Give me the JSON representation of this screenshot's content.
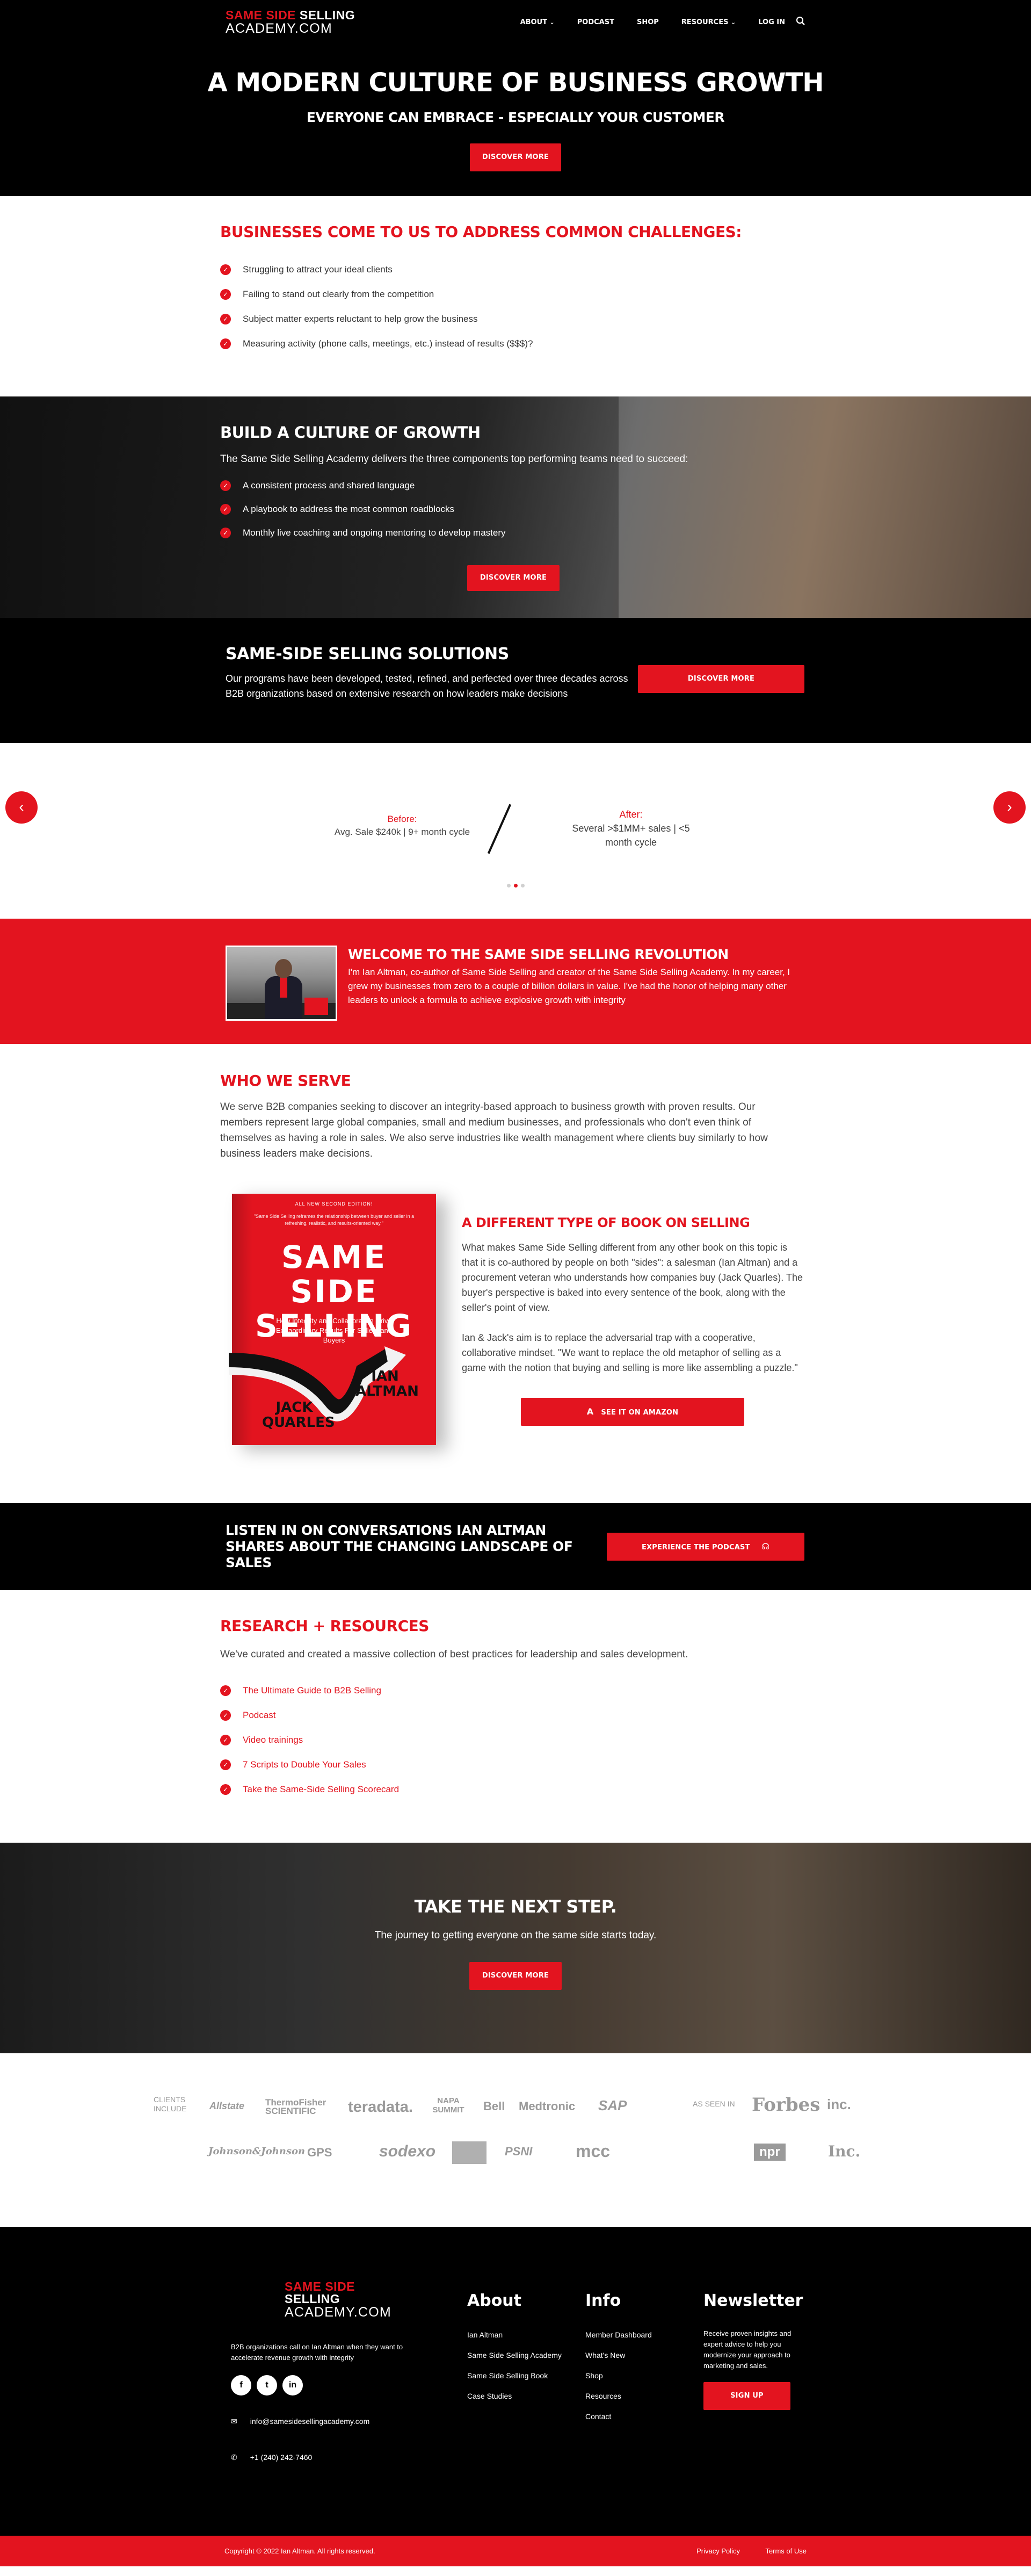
{
  "header": {
    "logo_red": "SAME SIDE",
    "logo_white": "SELLING",
    "logo_sub": "ACADEMY.COM",
    "nav": [
      {
        "label": "ABOUT",
        "dropdown": true
      },
      {
        "label": "PODCAST",
        "dropdown": false
      },
      {
        "label": "SHOP",
        "dropdown": false
      },
      {
        "label": "RESOURCES",
        "dropdown": true
      },
      {
        "label": "LOG IN",
        "dropdown": false
      }
    ],
    "chevron": "⌄"
  },
  "hero": {
    "title": "A MODERN CULTURE OF BUSINESS GROWTH",
    "subtitle": "EVERYONE CAN EMBRACE - ESPECIALLY YOUR CUSTOMER",
    "button": "DISCOVER MORE"
  },
  "challenges": {
    "title": "BUSINESSES COME TO US TO ADDRESS COMMON CHALLENGES:",
    "items": [
      "Struggling to attract your ideal clients",
      "Failing to stand out clearly from the competition",
      "Subject matter experts reluctant to help grow the business",
      "Measuring activity (phone calls, meetings, etc.) instead of results ($$$)?"
    ]
  },
  "culture": {
    "title": "BUILD A CULTURE OF GROWTH",
    "lead": "The Same Side Selling Academy delivers the three components top performing teams need to succeed:",
    "items": [
      "A consistent process and shared language",
      "A playbook to address the most common roadblocks",
      "Monthly live coaching and ongoing mentoring to develop mastery"
    ],
    "button": "DISCOVER MORE"
  },
  "solutions": {
    "title": "SAME-SIDE SELLING SOLUTIONS",
    "text": "Our programs have been developed, tested, refined, and perfected over three decades across B2B organizations based on extensive research on how leaders make decisions",
    "button": "DISCOVER MORE"
  },
  "slider": {
    "before_label": "Before:",
    "before_text": "Avg. Sale $240k | 9+ month cycle",
    "after_label": "After:",
    "after_text": "Several >$1MM+ sales | <5 month cycle",
    "prev": "‹",
    "next": "›"
  },
  "welcome": {
    "title": "WELCOME TO THE SAME SIDE SELLING REVOLUTION",
    "text": "I'm Ian Altman, co-author of Same Side Selling and creator of the Same Side Selling Academy. In my career, I grew my businesses from zero to a couple of billion dollars in value. I've had the honor of helping many other leaders to unlock a formula to achieve explosive growth with integrity"
  },
  "who": {
    "title": "WHO WE SERVE",
    "text": "We serve B2B companies seeking to discover an integrity-based approach to business growth with proven results. Our members represent large global companies, small and medium businesses, and professionals who don't even think of themselves as having a role in sales. We also serve industries like wealth management where clients buy similarly to how business leaders make decisions."
  },
  "book": {
    "cover_edition": "ALL NEW SECOND EDITION!",
    "cover_blurb": "\"Same Side Selling reframes the relationship between buyer and seller in a refreshing, realistic, and results-oriented way.\"",
    "cover_title": "SAME SIDE SELLING",
    "cover_subtitle": "How Integrity and Collaboration Drive Extraordinary Results For Sellers and Buyers",
    "cover_author1": "IAN ALTMAN",
    "cover_author2": "JACK QUARLES",
    "title": "A DIFFERENT TYPE OF BOOK ON SELLING",
    "p1": "What makes Same Side Selling different from any other book on this topic is that it is co-authored by people on both \"sides\": a salesman (Ian Altman) and a procurement veteran who understands how companies buy (Jack Quarles). The buyer's perspective is baked into every sentence of the book, along with the seller's point of view.",
    "p2": "Ian & Jack's aim is to replace the adversarial trap with a cooperative, collaborative mindset. \"We want to replace the old metaphor of selling as a game with the notion that buying and selling is more like assembling a puzzle.\"",
    "button": "SEE IT ON AMAZON",
    "amazon_icon": "a"
  },
  "podcast": {
    "title": "LISTEN IN ON CONVERSATIONS IAN ALTMAN SHARES ABOUT THE CHANGING LANDSCAPE OF SALES",
    "button": "EXPERIENCE THE PODCAST",
    "headphone_icon": "☊"
  },
  "research": {
    "title": "RESEARCH + RESOURCES",
    "text": "We've curated and created a massive collection of best practices for leadership and sales development.",
    "links": [
      "The Ultimate Guide to B2B Selling",
      "Podcast",
      "Video trainings",
      "7 Scripts to Double Your Sales",
      "Take the Same-Side Selling Scorecard"
    ]
  },
  "nextstep": {
    "title": "TAKE THE NEXT STEP.",
    "text": "The journey to getting everyone on the same side starts today.",
    "button": "DISCOVER MORE"
  },
  "logos": {
    "clients_label": "CLIENTS INCLUDE",
    "clients_row1": [
      "Allstate",
      "ThermoFisher SCIENTIFIC",
      "teradata.",
      "NAPA SUMMIT",
      "Bell",
      "Medtronic",
      "SAP"
    ],
    "clients_row2": [
      "Johnson&Johnson",
      "GPS",
      "sodexo",
      "",
      "PSNI",
      "mcc"
    ],
    "seen_label": "AS SEEN IN",
    "seen_row1": [
      "Forbes",
      "inc."
    ],
    "seen_row2": [
      "npr",
      "Inc."
    ]
  },
  "footer": {
    "logo_red": "SAME SIDE",
    "logo_white": "SELLING",
    "logo_sub": "ACADEMY.COM",
    "tagline": "B2B organizations call on Ian Altman when they want to accelerate revenue growth with integrity",
    "social": [
      "f",
      "t",
      "in"
    ],
    "email": "info@samesidesellingacademy.com",
    "phone": "+1 (240) 242-7460",
    "email_icon": "✉",
    "phone_icon": "✆",
    "about_title": "About",
    "about_links": [
      "Ian Altman",
      "Same Side Selling Academy",
      "Same Side Selling Book",
      "Case Studies"
    ],
    "info_title": "Info",
    "info_links": [
      "Member Dashboard",
      "What's New",
      "Shop",
      "Resources",
      "Contact"
    ],
    "newsletter_title": "Newsletter",
    "newsletter_text": "Receive proven insights and expert advice to help you modernize your approach to marketing and sales.",
    "signup": "SIGN UP"
  },
  "bottom": {
    "copyright": "Copyright © 2022 Ian Altman. All rights reserved.",
    "privacy": "Privacy Policy",
    "terms": "Terms of Use"
  }
}
